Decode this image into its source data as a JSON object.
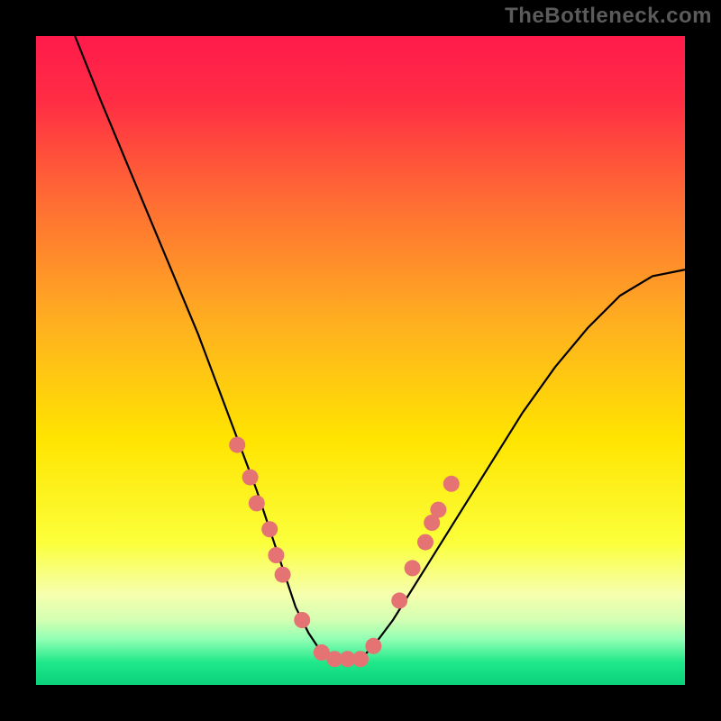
{
  "watermark": "TheBottleneck.com",
  "chart_data": {
    "type": "line",
    "title": "",
    "xlabel": "",
    "ylabel": "",
    "xlim": [
      0,
      100
    ],
    "ylim": [
      0,
      100
    ],
    "grid": false,
    "legend": null,
    "background_gradient_stops": [
      {
        "offset": 0.0,
        "color": "#ff1a4b"
      },
      {
        "offset": 0.1,
        "color": "#ff2d44"
      },
      {
        "offset": 0.25,
        "color": "#ff6b34"
      },
      {
        "offset": 0.45,
        "color": "#ffb21f"
      },
      {
        "offset": 0.62,
        "color": "#ffe400"
      },
      {
        "offset": 0.78,
        "color": "#fbff3a"
      },
      {
        "offset": 0.86,
        "color": "#f6ffae"
      },
      {
        "offset": 0.9,
        "color": "#d4ffb3"
      },
      {
        "offset": 0.93,
        "color": "#8fffb3"
      },
      {
        "offset": 0.965,
        "color": "#20e88a"
      },
      {
        "offset": 1.0,
        "color": "#0ad17a"
      }
    ],
    "series": [
      {
        "name": "bottleneck-curve",
        "color": "#000000",
        "x": [
          6,
          10,
          15,
          20,
          25,
          28,
          31,
          34,
          36,
          38,
          40,
          42,
          44,
          46,
          48,
          50,
          52,
          55,
          60,
          65,
          70,
          75,
          80,
          85,
          90,
          95,
          100
        ],
        "y": [
          100,
          90,
          78,
          66,
          54,
          46,
          38,
          30,
          24,
          18,
          12,
          8,
          5,
          4,
          4,
          4,
          6,
          10,
          18,
          26,
          34,
          42,
          49,
          55,
          60,
          63,
          64
        ]
      }
    ],
    "markers": {
      "name": "highlight-dots",
      "color": "#e57373",
      "radius": 9,
      "points": [
        {
          "x": 31,
          "y": 37
        },
        {
          "x": 33,
          "y": 32
        },
        {
          "x": 34,
          "y": 28
        },
        {
          "x": 36,
          "y": 24
        },
        {
          "x": 37,
          "y": 20
        },
        {
          "x": 38,
          "y": 17
        },
        {
          "x": 41,
          "y": 10
        },
        {
          "x": 44,
          "y": 5
        },
        {
          "x": 46,
          "y": 4
        },
        {
          "x": 48,
          "y": 4
        },
        {
          "x": 50,
          "y": 4
        },
        {
          "x": 52,
          "y": 6
        },
        {
          "x": 56,
          "y": 13
        },
        {
          "x": 58,
          "y": 18
        },
        {
          "x": 60,
          "y": 22
        },
        {
          "x": 61,
          "y": 25
        },
        {
          "x": 62,
          "y": 27
        },
        {
          "x": 64,
          "y": 31
        }
      ]
    }
  }
}
